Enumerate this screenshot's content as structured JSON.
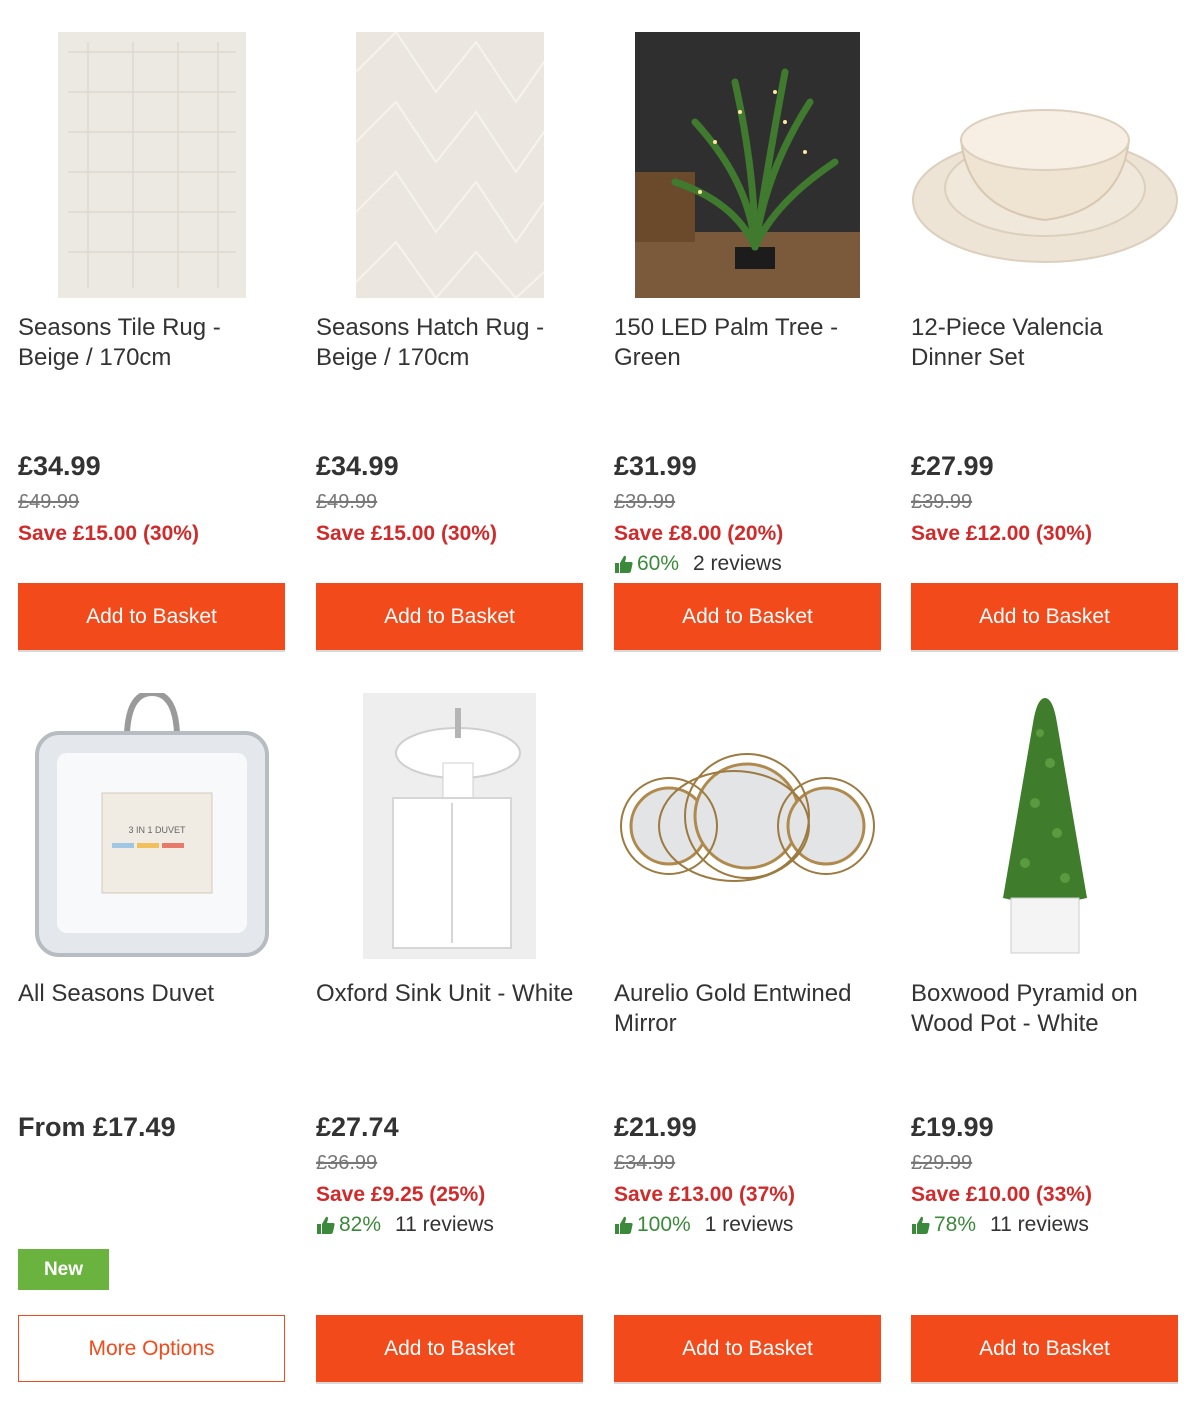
{
  "products": [
    {
      "title": "Seasons Tile Rug - Beige / 170cm",
      "price": "£34.99",
      "was": "£49.99",
      "save": "Save £15.00 (30%)",
      "button": "Add to Basket",
      "image": "beige-tile-rug-image"
    },
    {
      "title": "Seasons Hatch Rug - Beige / 170cm",
      "price": "£34.99",
      "was": "£49.99",
      "save": "Save £15.00 (30%)",
      "button": "Add to Basket",
      "image": "beige-hatch-rug-image"
    },
    {
      "title": "150 LED Palm Tree - Green",
      "price": "£31.99",
      "was": "£39.99",
      "save": "Save £8.00 (20%)",
      "rating": "60%",
      "reviews": "2 reviews",
      "button": "Add to Basket",
      "image": "led-palm-tree-image"
    },
    {
      "title": "12-Piece Valencia Dinner Set",
      "price": "£27.99",
      "was": "£39.99",
      "save": "Save £12.00 (30%)",
      "button": "Add to Basket",
      "image": "dinner-set-image"
    },
    {
      "title": "All Seasons Duvet",
      "price": "From £17.49",
      "badge": "New",
      "button": "More Options",
      "image": "duvet-package-image"
    },
    {
      "title": "Oxford Sink Unit - White",
      "price": "£27.74",
      "was": "£36.99",
      "save": "Save £9.25 (25%)",
      "rating": "82%",
      "reviews": "11 reviews",
      "button": "Add to Basket",
      "image": "sink-unit-image"
    },
    {
      "title": "Aurelio Gold Entwined Mirror",
      "price": "£21.99",
      "was": "£34.99",
      "save": "Save £13.00 (37%)",
      "rating": "100%",
      "reviews": "1 reviews",
      "button": "Add to Basket",
      "image": "gold-mirror-image"
    },
    {
      "title": "Boxwood Pyramid on Wood Pot - White",
      "price": "£19.99",
      "was": "£29.99",
      "save": "Save £10.00 (33%)",
      "rating": "78%",
      "reviews": "11 reviews",
      "button": "Add to Basket",
      "image": "boxwood-pyramid-image"
    }
  ],
  "colors": {
    "accent": "#f24a1b",
    "sale": "#d12a2a",
    "rating": "#3b8a3b",
    "new_badge": "#6ab33f"
  },
  "icons": {
    "rating": "thumbs-up-icon"
  }
}
